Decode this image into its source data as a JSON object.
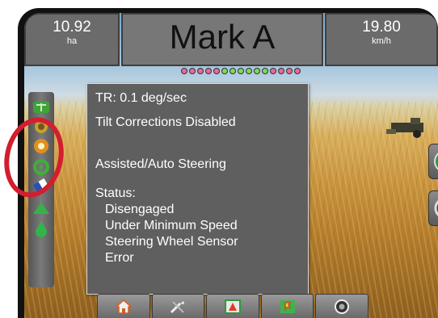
{
  "header": {
    "left_metric": {
      "value": "10.92",
      "unit": "ha"
    },
    "title": "Mark A",
    "right_metric": {
      "value": "19.80",
      "unit": "km/h"
    },
    "guidance_leds": [
      "#e86a9c",
      "#e86a9c",
      "#e86a9c",
      "#e86a9c",
      "#e86a9c",
      "#7ed957",
      "#7ed957",
      "#7ed957",
      "#7ed957",
      "#7ed957",
      "#7ed957",
      "#e86a9c",
      "#e86a9c",
      "#e86a9c",
      "#e86a9c"
    ]
  },
  "status_popup": {
    "tr_line": "TR: 0.1 deg/sec",
    "tilt_line": "Tilt Corrections Disabled",
    "mode_line": "Assisted/Auto Steering",
    "status_label": "Status:",
    "status_lines": [
      "Disengaged",
      "Under Minimum Speed",
      "Steering Wheel Sensor",
      "Error"
    ]
  },
  "left_toolbar": {
    "icons": [
      "boom-status-icon",
      "gnss-status-icon",
      "boundary-status-icon",
      "steering-status-icon",
      "tilt-status-icon",
      "guidance-mode-icon",
      "product-icon"
    ]
  },
  "right_buttons": [
    "vehicle-view-icon",
    "screen-options-icon"
  ],
  "bottom_nav": [
    "home-icon",
    "tools-icon",
    "guidance-view-icon",
    "field-map-icon",
    "camera-icon"
  ],
  "colors": {
    "annotation_ring": "#d21e2e",
    "panel": "#5f5f5f"
  }
}
